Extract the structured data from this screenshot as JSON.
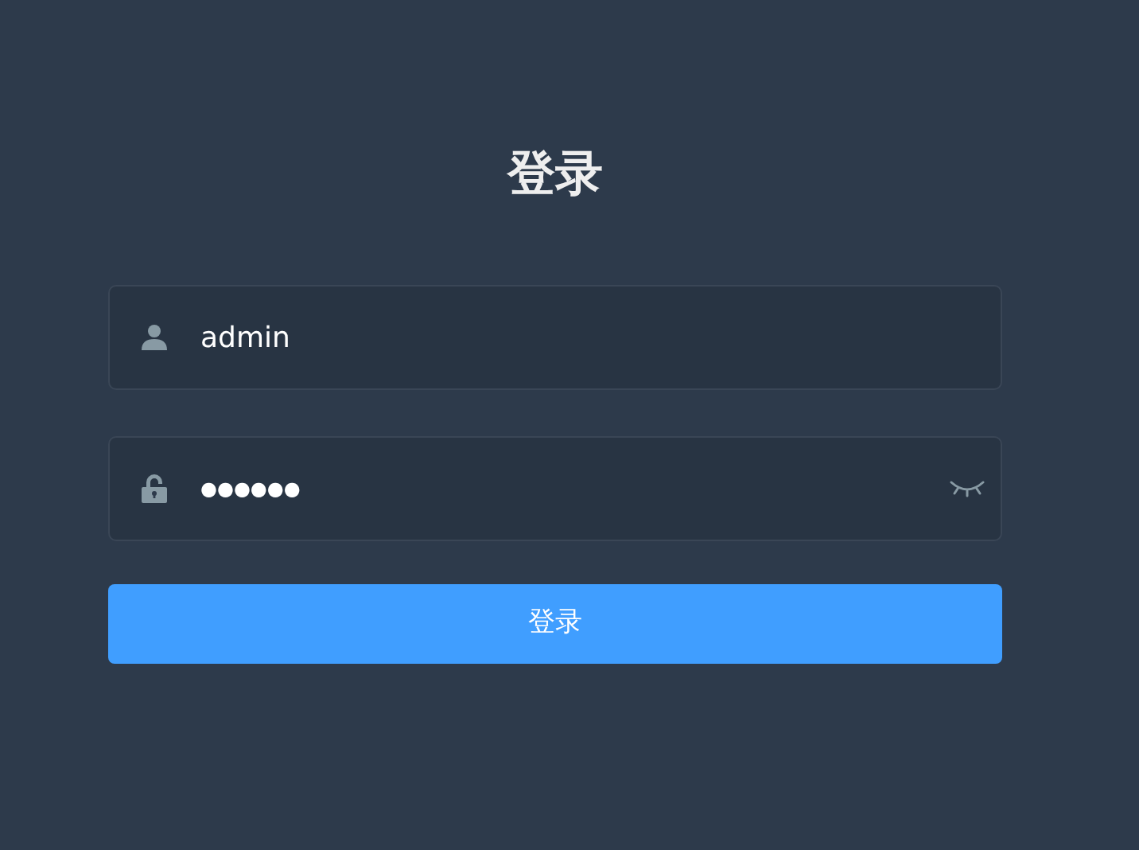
{
  "title": "登录",
  "fields": [
    {
      "kind": "user",
      "value": "admin"
    },
    {
      "kind": "password",
      "value": "●●●●●●"
    }
  ],
  "submit": {
    "label": "登录"
  }
}
